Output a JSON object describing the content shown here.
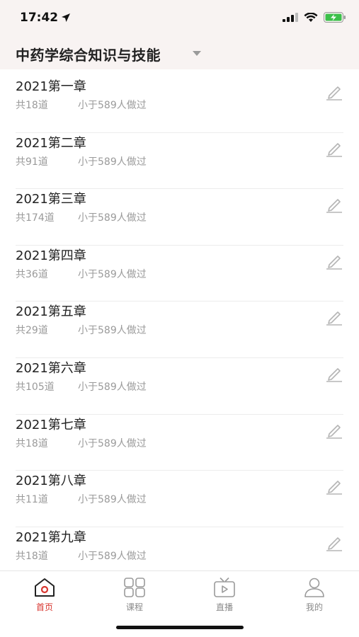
{
  "status_bar": {
    "time": "17:42"
  },
  "header": {
    "title": "中药学综合知识与技能"
  },
  "chapters": [
    {
      "title": "2021第一章",
      "count": "共18道",
      "done": "小于589人做过"
    },
    {
      "title": "2021第二章",
      "count": "共91道",
      "done": "小于589人做过"
    },
    {
      "title": "2021第三章",
      "count": "共174道",
      "done": "小于589人做过"
    },
    {
      "title": "2021第四章",
      "count": "共36道",
      "done": "小于589人做过"
    },
    {
      "title": "2021第五章",
      "count": "共29道",
      "done": "小于589人做过"
    },
    {
      "title": "2021第六章",
      "count": "共105道",
      "done": "小于589人做过"
    },
    {
      "title": "2021第七章",
      "count": "共18道",
      "done": "小于589人做过"
    },
    {
      "title": "2021第八章",
      "count": "共11道",
      "done": "小于589人做过"
    },
    {
      "title": "2021第九章",
      "count": "共18道",
      "done": "小于589人做过"
    }
  ],
  "tab_bar": {
    "tabs": [
      {
        "label": "首页",
        "icon": "home-icon",
        "active": true
      },
      {
        "label": "课程",
        "icon": "grid-icon",
        "active": false
      },
      {
        "label": "直播",
        "icon": "tv-play-icon",
        "active": false
      },
      {
        "label": "我的",
        "icon": "user-icon",
        "active": false
      }
    ]
  },
  "colors": {
    "accent": "#d8362f",
    "header_bg": "#f8f3f2",
    "muted_text": "#9a9a9a"
  }
}
